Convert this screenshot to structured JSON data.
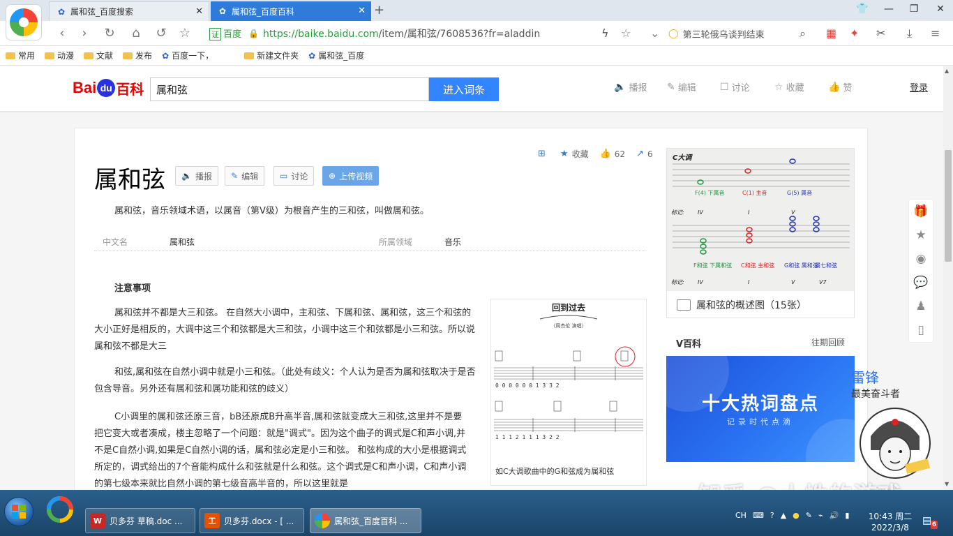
{
  "tabs": [
    {
      "label": "属和弦_百度搜索",
      "active": false
    },
    {
      "label": "属和弦_百度百科",
      "active": true
    }
  ],
  "address": {
    "cert_badge": "证",
    "cert_text": "百度",
    "url_main": "https://baike.baidu.com",
    "url_rest": "/item/属和弦/7608536?fr=aladdin"
  },
  "search_box": {
    "text": "第三轮俄乌谈判结束"
  },
  "bookmarks": [
    "常用",
    "动漫",
    "文献",
    "发布",
    "百度一下，",
    "新建文件夹",
    "属和弦_百度"
  ],
  "header": {
    "logo_bai": "Bai",
    "logo_du": "du",
    "logo_baike": "百科",
    "search_value": "属和弦",
    "search_button": "进入词条",
    "actions": [
      "播报",
      "编辑",
      "讨论",
      "收藏",
      "赞"
    ],
    "login": "登录"
  },
  "stats": {
    "favorite": "收藏",
    "likes": "62",
    "shares": "6"
  },
  "lemma": {
    "title": "属和弦",
    "buttons": [
      "播报",
      "编辑",
      "讨论",
      "上传视频"
    ],
    "summary": "属和弦，音乐领域术语，以属音（第Ⅴ级）为根音产生的三和弦，叫做属和弦。",
    "basic_info": [
      {
        "key": "中文名",
        "value": "属和弦"
      },
      {
        "key": "所属领域",
        "value": "音乐"
      }
    ]
  },
  "notes": {
    "heading": "注意事项",
    "paragraphs": [
      "属和弦并不都是大三和弦。 在自然大小调中，主和弦、下属和弦、属和弦，这三个和弦的大小正好是相反的，大调中这三个和弦都是大三和弦，小调中这三个和弦都是小三和弦。所以说属和弦不都是大三",
      "和弦,属和弦在自然小调中就是小三和弦。（此处有歧义：个人认为是否为属和弦取决于是否包含导音。另外还有属和弦和属功能和弦的歧义）",
      "C小调里的属和弦还原三音，bB还原成B升高半音,属和弦就变成大三和弦,这里并不是要把它变大或者凑成，楼主忽略了一个问题：就是\"调式\"。因为这个曲子的调式是C和声小调,并不是C自然小调,如果是C自然小调的话，属和弦必定是小三和弦。 和弦构成的大小是根据调式所定的，调式给出的7个音能构成什么和弦就是什么和弦。这个调式是C和声小调，C和声小调的第七级本来就比自然小调的第七级音高半音的，所以这里就是"
    ]
  },
  "figure": {
    "sheet_title": "回到过去",
    "sheet_subtitle": "（周杰伦 演唱）",
    "caption": "如C大调歌曲中的G和弦成为属和弦"
  },
  "album": {
    "key_label": "C大调",
    "chord_labels": [
      "F(4) 下属音",
      "C(1) 主音",
      "G(5) 属音"
    ],
    "degrees": [
      "IV",
      "I",
      "V",
      "V7"
    ],
    "row_labels": [
      "标记:",
      "标记:"
    ],
    "bottom_labels": [
      "F和弦 下属和弦",
      "C和弦 主和弦",
      "G和弦 属和弦",
      "属七和弦"
    ],
    "caption": "属和弦的概述图（15张）"
  },
  "vbaike": {
    "title": "V百科",
    "more": "往期回顾",
    "banner_main": "十大热词盘点",
    "banner_sub": "记录时代点滴"
  },
  "promo": {
    "line1": "雷锋",
    "line2": "最美奋斗者"
  },
  "watermark": "知乎 @人性的游戏",
  "taskbar": {
    "tasks": [
      "贝多芬 草稿.doc ...",
      "贝多芬.docx - [ ...",
      "属和弦_百度百科 ..."
    ],
    "tray": [
      "CH",
      "⌨",
      "?"
    ],
    "time": "10:43 周二",
    "date": "2022/3/8",
    "notif_count": "6"
  },
  "colors": {
    "baidu_blue": "#3385ff",
    "link": "#136ec2",
    "tab_active": "#2f7bd9",
    "baidu_red": "#e10601"
  }
}
